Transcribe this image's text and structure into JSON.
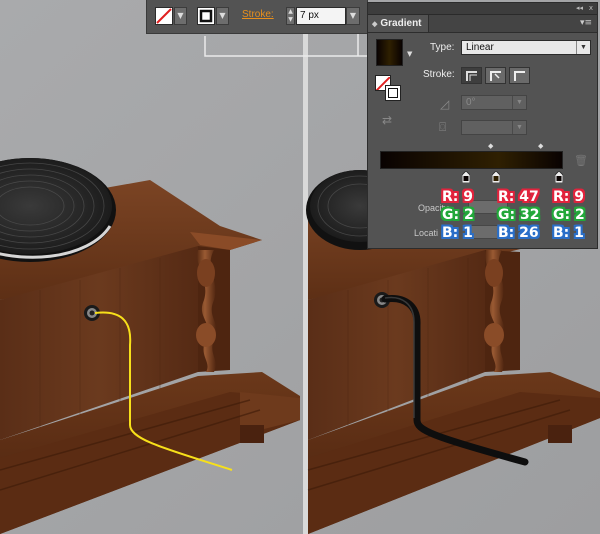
{
  "toolbar": {
    "stroke_label": "Stroke:",
    "stroke_weight": "7 px",
    "spin_up": "▲",
    "spin_down": "▼",
    "dropdown_arrow": "▼"
  },
  "gradient_panel": {
    "tab_label": "Gradient",
    "collapse_icon": "◂◂",
    "close_icon": "x",
    "menu_icon": "▾≡",
    "type_label": "Type:",
    "type_value": "Linear",
    "stroke_label": "Stroke:",
    "angle_value": "0°",
    "opacity_label": "Opacity",
    "location_label": "Locati",
    "trash_icon": "🗑",
    "stops": [
      {
        "r": "R: 9",
        "g": "G: 2",
        "b": "B: 1"
      },
      {
        "r": "R: 47",
        "g": "G: 32",
        "b": "B: 26"
      },
      {
        "r": "R: 9",
        "g": "G: 2",
        "b": "B: 1"
      }
    ]
  },
  "colors": {
    "accent_orange": "#e88f1c",
    "red_label": "#e2233d",
    "green_label": "#22a83a",
    "blue_label": "#2a6fc9",
    "cable_yellow": "#f7e01a"
  }
}
